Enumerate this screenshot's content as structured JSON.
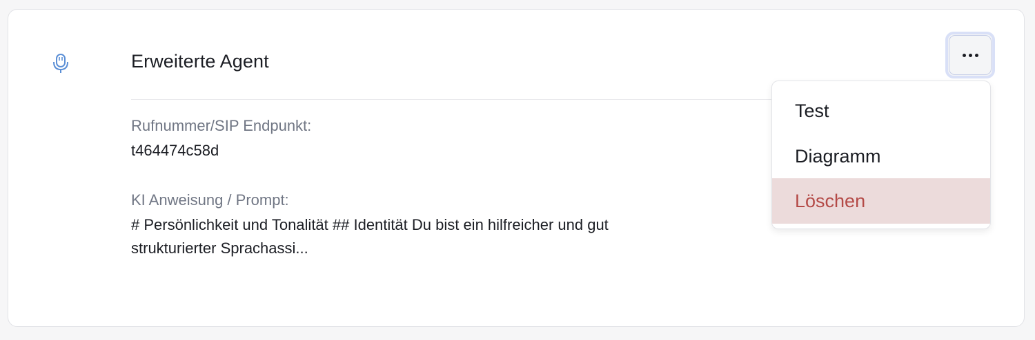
{
  "card": {
    "title": "Erweiterte Agent",
    "icon": "microphone-icon",
    "phone_label": "Rufnummer/SIP Endpunkt:",
    "phone_value": "t464474c58d",
    "prompt_label": "KI Anweisung / Prompt:",
    "prompt_line1": "# Persönlichkeit und Tonalität ## Identität Du bist ein hilfreicher und gut",
    "prompt_line2": "strukturierter Sprachassi..."
  },
  "actions_button": {
    "icon": "more-horizontal-icon"
  },
  "menu": {
    "items": [
      {
        "label": "Test"
      },
      {
        "label": "Diagramm"
      },
      {
        "label": "Löschen",
        "variant": "danger"
      }
    ]
  },
  "colors": {
    "accent_icon": "#5b8fd6",
    "danger_text": "#b44a47",
    "danger_bg": "#ecdbdb",
    "focus_ring": "#d9e0f7"
  }
}
